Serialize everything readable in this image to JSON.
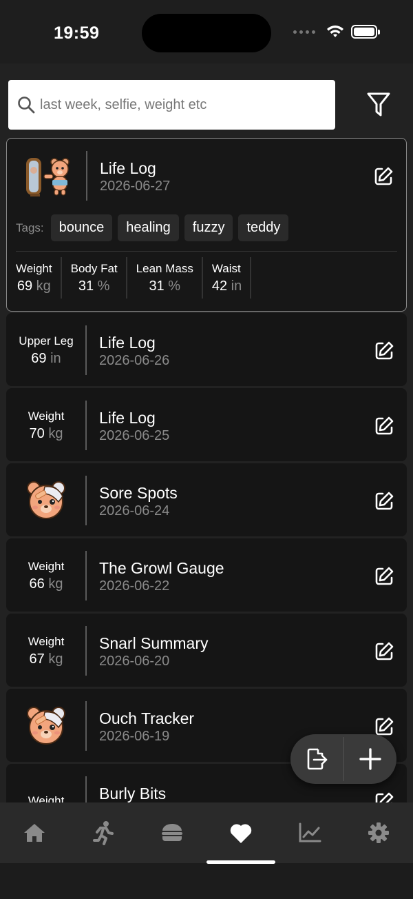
{
  "status": {
    "time": "19:59"
  },
  "search": {
    "placeholder": "last week, selfie, weight etc"
  },
  "entries": [
    {
      "title": "Life Log",
      "date": "2026-06-27",
      "thumb": "bear-mirror-selfie",
      "tags_label": "Tags:",
      "tags": [
        "bounce",
        "healing",
        "fuzzy",
        "teddy"
      ],
      "metrics": [
        {
          "label": "Weight",
          "value": "69",
          "unit": "kg"
        },
        {
          "label": "Body Fat",
          "value": "31",
          "unit": "%"
        },
        {
          "label": "Lean Mass",
          "value": "31",
          "unit": "%"
        },
        {
          "label": "Waist",
          "value": "42",
          "unit": "in"
        }
      ]
    },
    {
      "title": "Life Log",
      "date": "2026-06-26",
      "metric_label": "Upper Leg",
      "metric_value": "69",
      "metric_unit": "in"
    },
    {
      "title": "Life Log",
      "date": "2026-06-25",
      "metric_label": "Weight",
      "metric_value": "70",
      "metric_unit": "kg"
    },
    {
      "title": "Sore Spots",
      "date": "2026-06-24",
      "thumb": "bandaged-bear"
    },
    {
      "title": "The Growl Gauge",
      "date": "2026-06-22",
      "metric_label": "Weight",
      "metric_value": "66",
      "metric_unit": "kg"
    },
    {
      "title": "Snarl Summary",
      "date": "2026-06-20",
      "metric_label": "Weight",
      "metric_value": "67",
      "metric_unit": "kg"
    },
    {
      "title": "Ouch Tracker",
      "date": "2026-06-19",
      "thumb": "bandaged-bear"
    },
    {
      "title": "Burly Bits",
      "metric_label": "Weight"
    }
  ],
  "tabs": [
    "home-icon",
    "running-icon",
    "burger-icon",
    "heart-icon",
    "chart-icon",
    "gear-icon"
  ],
  "colors": {
    "background": "#222222",
    "card": "#151515",
    "accent": "#ffffff",
    "muted": "#8a8a8a"
  }
}
